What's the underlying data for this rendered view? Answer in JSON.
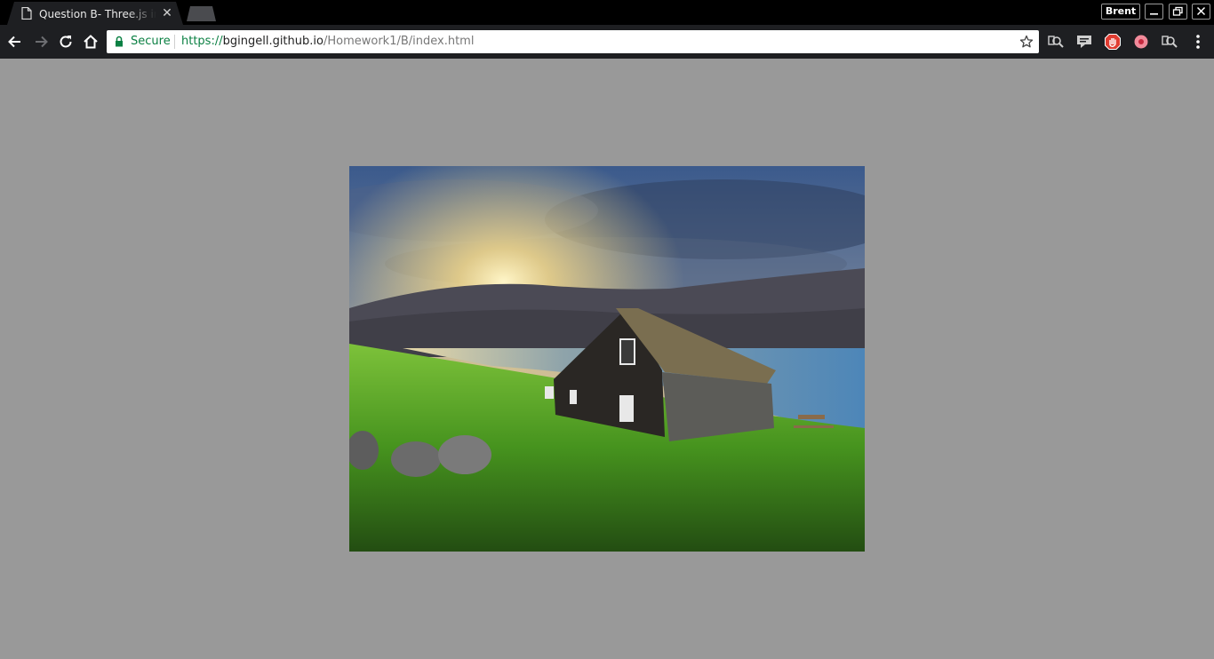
{
  "tab": {
    "title": "Question B- Three.js in"
  },
  "window": {
    "profile_name": "Brent"
  },
  "omnibox": {
    "secure_label": "Secure",
    "url_scheme": "https://",
    "url_host": "bgingell.github.io",
    "url_path": "/Homework1/B/index.html"
  },
  "icons": {
    "tab_favicon": "page-icon",
    "back": "arrow-left-icon",
    "forward": "arrow-right-icon",
    "reload": "reload-icon",
    "home": "home-icon",
    "lock": "lock-icon",
    "bookmark": "star-icon",
    "menu": "kebab-menu-icon"
  },
  "colors": {
    "page_background": "#999999",
    "secure_green": "#0b8043",
    "toolbar_dark": "#1e1f22"
  }
}
